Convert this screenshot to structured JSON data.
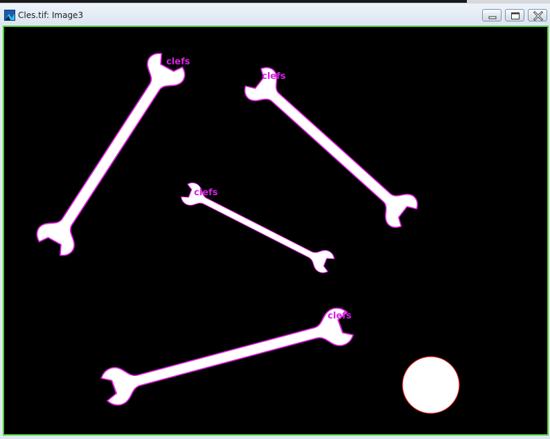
{
  "window": {
    "title": "Cles.tif: Image3"
  },
  "colors": {
    "canvas_background": "#000000",
    "object_fill": "#ffffff",
    "object_outline": "#e020e0",
    "circle_outline": "#e02020",
    "label": "#d91fe6",
    "image_border": "#4ad12a"
  },
  "icons": {
    "app": "image-app-icon",
    "minimize": "minimize-icon",
    "maximize": "maximize-icon",
    "close": "close-icon"
  },
  "objects": {
    "labels": [
      "clefs",
      "clefs",
      "clefs",
      "clefs"
    ]
  }
}
